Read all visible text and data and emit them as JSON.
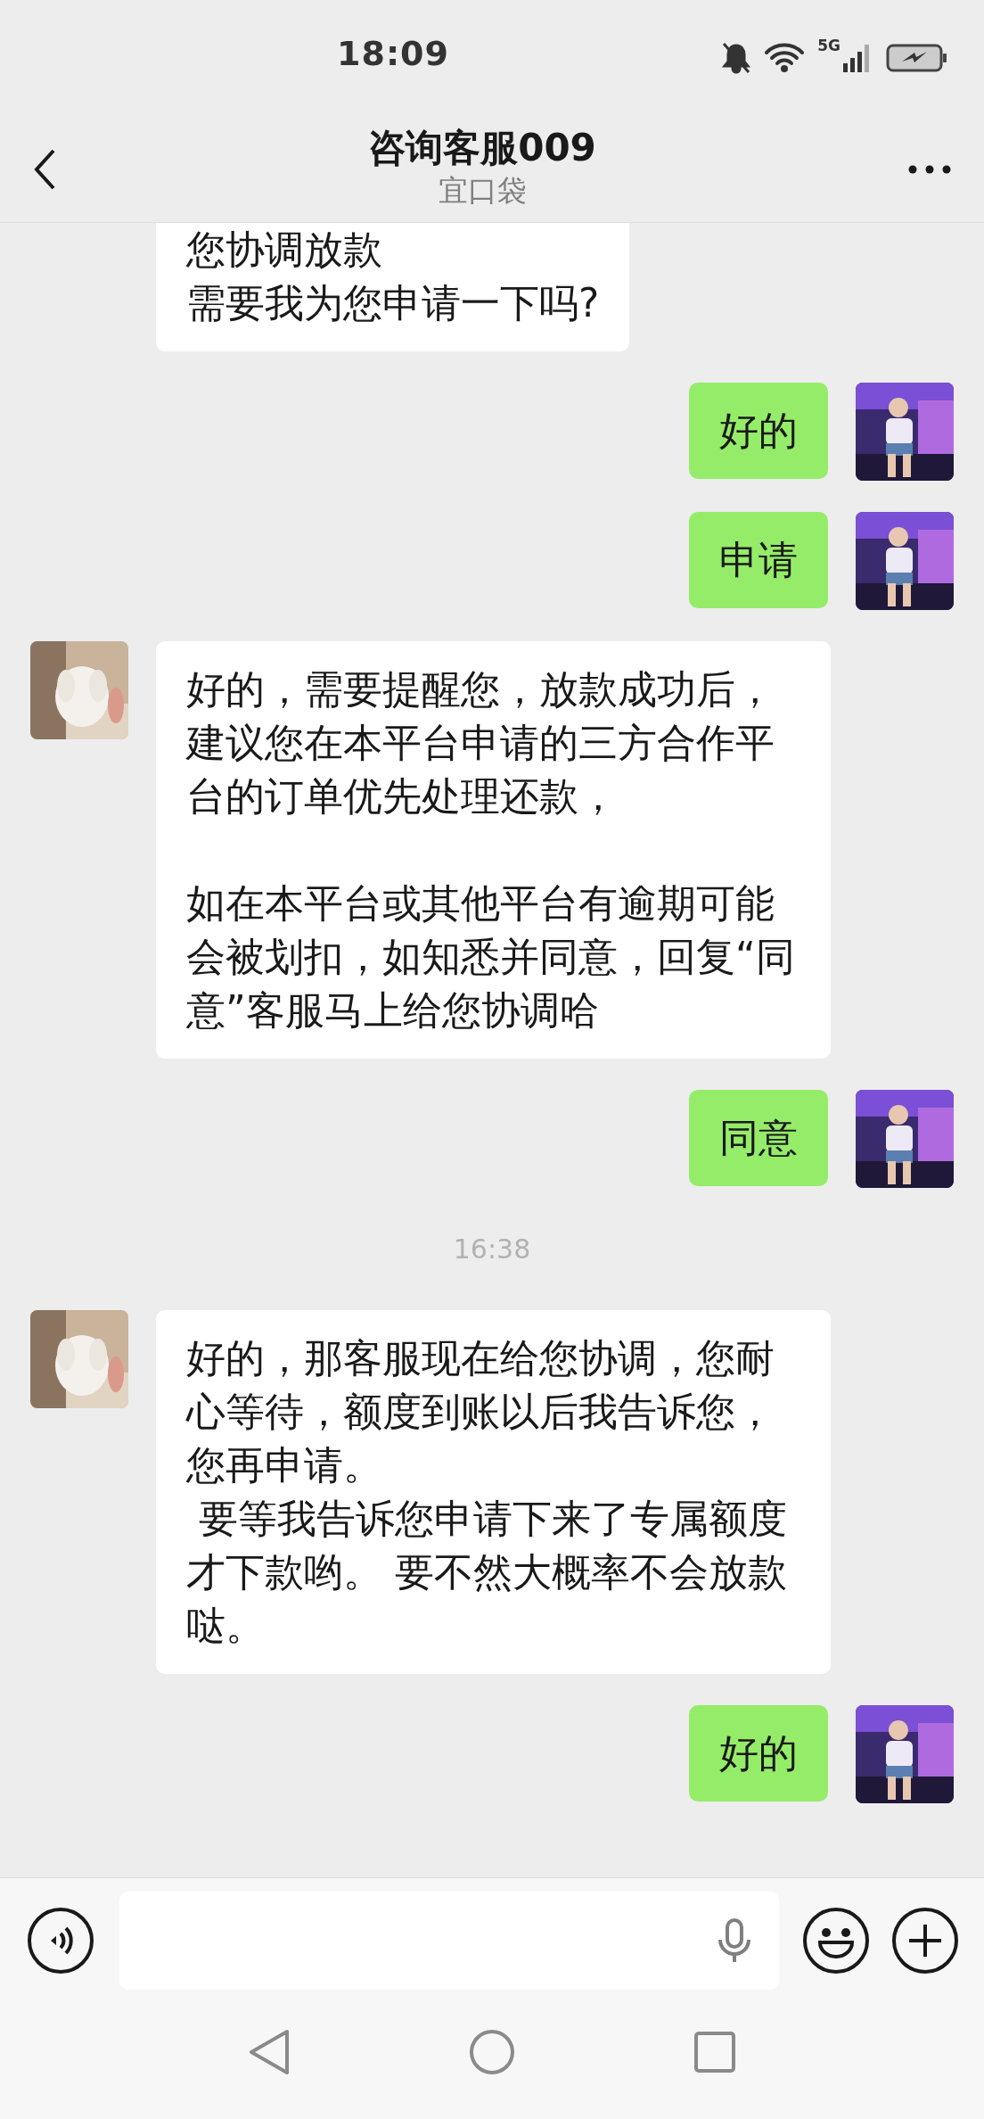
{
  "status_bar": {
    "time": "18:09",
    "network": "5G"
  },
  "header": {
    "title": "咨询客服009",
    "subtitle": "宜口袋"
  },
  "messages": [
    {
      "kind": "incoming",
      "paragraphs": [
        [
          "您协调放款",
          "需要我为您申请一下吗?"
        ]
      ]
    },
    {
      "kind": "outgoing",
      "paragraphs": [
        [
          "好的"
        ]
      ]
    },
    {
      "kind": "outgoing",
      "paragraphs": [
        [
          "申请"
        ]
      ]
    },
    {
      "kind": "incoming",
      "paragraphs": [
        [
          "好的，需要提醒您，放款成功后，建议您在本平台申请的三方合作平台的订单优先处理还款，"
        ],
        [
          "如在本平台或其他平台有逾期可能会被划扣，如知悉并同意，回复“同意”客服马上给您协调哈"
        ]
      ]
    },
    {
      "kind": "outgoing",
      "paragraphs": [
        [
          "同意"
        ]
      ]
    },
    {
      "kind": "time",
      "text": "16:38"
    },
    {
      "kind": "incoming",
      "paragraphs": [
        [
          "好的，那客服现在给您协调，您耐心等待，额度到账以后我告诉您，您再申请。",
          " 要等我告诉您申请下来了专属额度才下款哟。 要不然大概率不会放款哒。"
        ]
      ]
    },
    {
      "kind": "outgoing",
      "paragraphs": [
        [
          "好的"
        ]
      ]
    }
  ]
}
